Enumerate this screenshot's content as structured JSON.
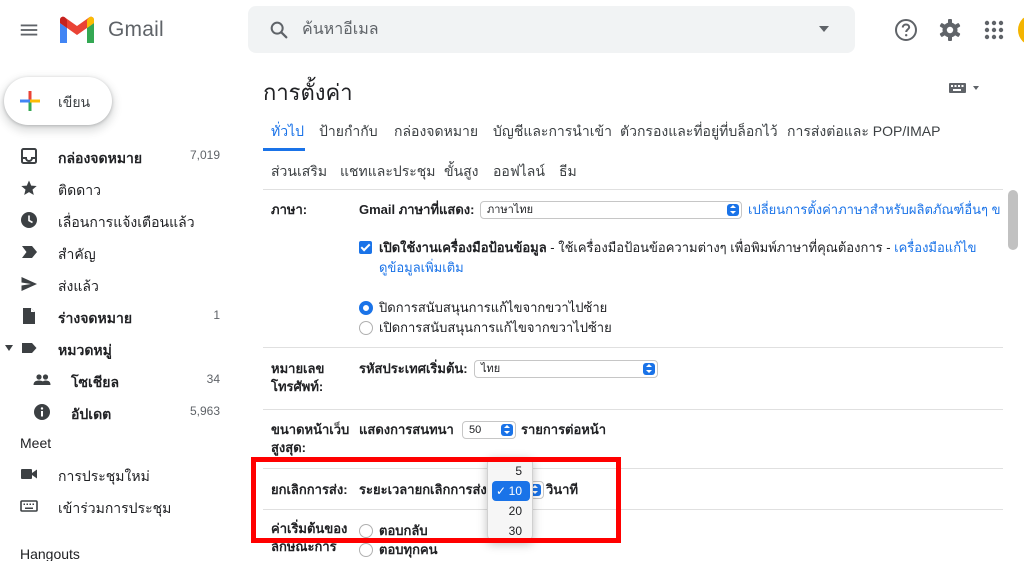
{
  "brand": "Gmail",
  "search": {
    "placeholder": "ค้นหาอีเมล"
  },
  "compose_label": "เขียน",
  "nav": [
    {
      "label": "กล่องจดหมาย",
      "count": "7,019",
      "bold": true,
      "icon": "inbox-icon"
    },
    {
      "label": "ติดดาว",
      "count": "",
      "bold": false,
      "icon": "star-icon"
    },
    {
      "label": "เลื่อนการแจ้งเตือนแล้ว",
      "count": "",
      "bold": false,
      "icon": "clock-icon"
    },
    {
      "label": "สำคัญ",
      "count": "",
      "bold": false,
      "icon": "label-important-icon"
    },
    {
      "label": "ส่งแล้ว",
      "count": "",
      "bold": false,
      "icon": "send-icon"
    },
    {
      "label": "ร่างจดหมาย",
      "count": "1",
      "bold": true,
      "icon": "draft-icon"
    },
    {
      "label": "หมวดหมู่",
      "count": "",
      "bold": true,
      "icon": "label-icon"
    },
    {
      "label": "โซเชียล",
      "count": "34",
      "bold": true,
      "icon": "people-icon"
    },
    {
      "label": "อัปเดต",
      "count": "5,963",
      "bold": true,
      "icon": "info-icon"
    }
  ],
  "meet": {
    "title": "Meet",
    "items": [
      {
        "label": "การประชุมใหม่",
        "icon": "video-icon"
      },
      {
        "label": "เข้าร่วมการประชุม",
        "icon": "keyboard-icon"
      }
    ]
  },
  "hangouts_title": "Hangouts",
  "settings": {
    "title": "การตั้งค่า",
    "tabs_row1": [
      "ทั่วไป",
      "ป้ายกำกับ",
      "กล่องจดหมาย",
      "บัญชีและการนำเข้า",
      "ตัวกรองและที่อยู่ที่บล็อกไว้",
      "การส่งต่อและ POP/IMAP"
    ],
    "tabs_row2": [
      "ส่วนเสริม",
      "แชทและประชุม",
      "ขั้นสูง",
      "ออฟไลน์",
      "ธีม"
    ],
    "language": {
      "label": "ภาษา:",
      "display_label": "Gmail ภาษาที่แสดง:",
      "display_value": "ภาษาไทย",
      "change_link": "เปลี่ยนการตั้งค่าภาษาสำหรับผลิตภัณฑ์อื่นๆ ข",
      "input_tools_bold": "เปิดใช้งานเครื่องมือป้อนข้อมูล",
      "input_tools_desc": " - ใช้เครื่องมือป้อนข้อความต่างๆ เพื่อพิมพ์ภาษาที่คุณต้องการ - ",
      "input_tools_link": "เครื่องมือแก้ไข",
      "more_link": "ดูข้อมูลเพิ่มเติม",
      "rtl_off": "ปิดการสนับสนุนการแก้ไขจากขวาไปซ้าย",
      "rtl_on": "เปิดการสนับสนุนการแก้ไขจากขวาไปซ้าย"
    },
    "phone": {
      "label": "หมายเลข\nโทรศัพท์:",
      "label_1": "หมายเลข",
      "label_2": "โทรศัพท์:",
      "country_label": "รหัสประเทศเริ่มต้น:",
      "country_value": "ไทย"
    },
    "page_size": {
      "label_1": "ขนาดหน้าเว็บ",
      "label_2": "สูงสุด:",
      "show_label": "แสดงการสนทนา",
      "value": "50",
      "suffix": "รายการต่อหน้า"
    },
    "undo_send": {
      "label": "ยกเลิกการส่ง:",
      "period_label": "ระยะเวลายกเลิกการส่ง",
      "unit": "วินาที",
      "options": [
        "5",
        "10",
        "20",
        "30"
      ],
      "selected": "10"
    },
    "reply": {
      "label_1": "ค่าเริ่มต้นของ",
      "label_2": "ลักษณะการ",
      "opt1": "ตอบกลับ",
      "opt2": "ตอบทุกคน"
    }
  },
  "colors": {
    "accent": "#1a73e8",
    "highlight": "#ff0000"
  }
}
